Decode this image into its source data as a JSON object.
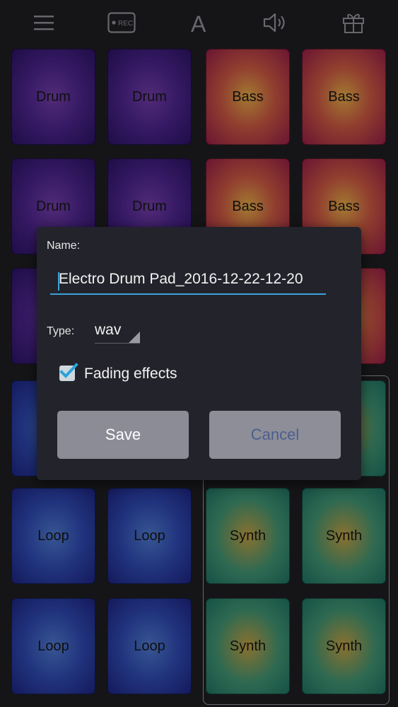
{
  "toolbar": {
    "rec_label": "REC",
    "font_glyph": "A",
    "icons": [
      "menu-icon",
      "rec-icon",
      "font-icon",
      "speaker-icon",
      "gift-icon"
    ]
  },
  "pads": [
    {
      "label": "Drum",
      "kind": "drum"
    },
    {
      "label": "Drum",
      "kind": "drum"
    },
    {
      "label": "Bass",
      "kind": "bass"
    },
    {
      "label": "Bass",
      "kind": "bass"
    },
    {
      "label": "Drum",
      "kind": "drum"
    },
    {
      "label": "Drum",
      "kind": "drum"
    },
    {
      "label": "Bass",
      "kind": "bass"
    },
    {
      "label": "Bass",
      "kind": "bass"
    },
    {
      "label": "Loop",
      "kind": "loop"
    },
    {
      "label": "Loop",
      "kind": "loop"
    },
    {
      "label": "Synth",
      "kind": "synth"
    },
    {
      "label": "Synth",
      "kind": "synth"
    },
    {
      "label": "Loop",
      "kind": "loop"
    },
    {
      "label": "Loop",
      "kind": "loop"
    },
    {
      "label": "Synth",
      "kind": "synth"
    },
    {
      "label": "Synth",
      "kind": "synth"
    }
  ],
  "dialog": {
    "name_label": "Name:",
    "name_value": "Electro Drum Pad_2016-12-22-12-20",
    "type_label": "Type:",
    "type_value": "wav",
    "fading_label": "Fading effects",
    "fading_checked": true,
    "save_label": "Save",
    "cancel_label": "Cancel"
  },
  "colors": {
    "accent": "#3aa2d8",
    "drum": "#4a2488",
    "bass": "#c2543f",
    "loop": "#2c45a8",
    "synth": "#3d8d6d"
  }
}
